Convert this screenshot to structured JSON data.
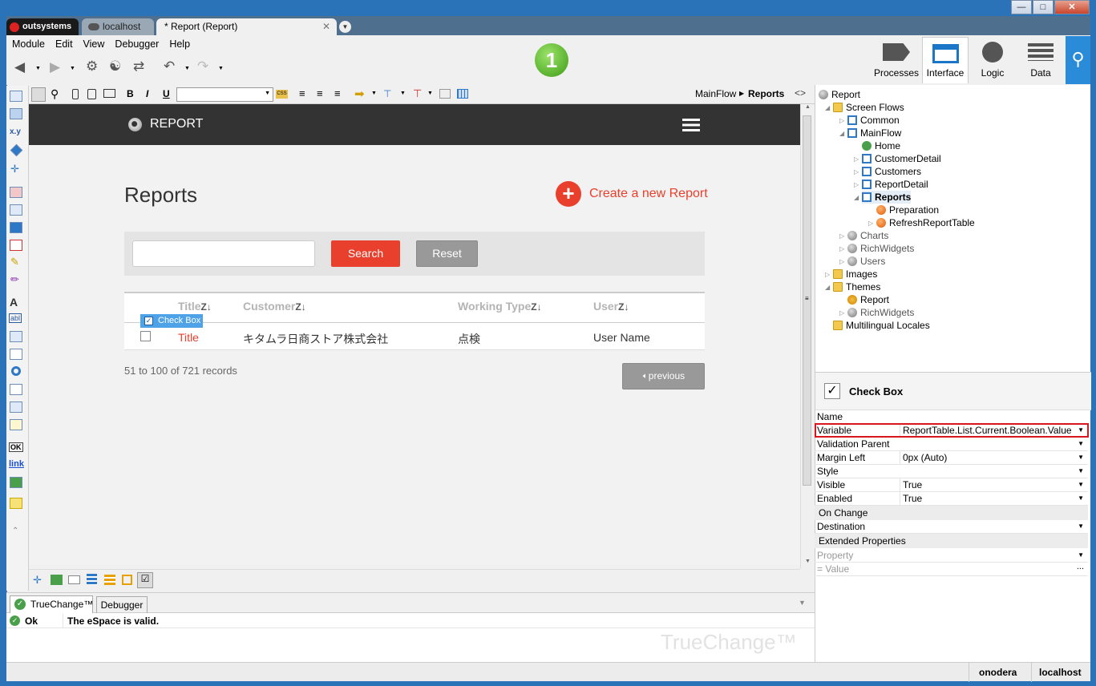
{
  "tabs": {
    "app": "outsystems",
    "server": "localhost",
    "doc": "* Report (Report)"
  },
  "menu": [
    "Module",
    "Edit",
    "View",
    "Debugger",
    "Help"
  ],
  "badge": "1",
  "modes": {
    "processes": "Processes",
    "interface": "Interface",
    "logic": "Logic",
    "data": "Data"
  },
  "breadcrumb": {
    "flow": "MainFlow",
    "screen": "Reports",
    "toggle": "<>"
  },
  "app": {
    "header_title": "REPORT",
    "page_title": "Reports",
    "create_label": "Create a new Report",
    "search_label": "Search",
    "reset_label": "Reset",
    "columns": [
      "Title",
      "Customer",
      "Working Type",
      "User"
    ],
    "sort_glyph": "Z↓",
    "tooltip": "Check Box",
    "row": {
      "title": "Title",
      "customer": "キタムラ日商ストア株式会社",
      "working_type": "点検",
      "user": "User Name"
    },
    "records": "51 to 100 of 721 records",
    "prev_label": "previous"
  },
  "tree": {
    "root": "Report",
    "screen_flows": "Screen Flows",
    "common": "Common",
    "mainflow": "MainFlow",
    "home": "Home",
    "customerdetail": "CustomerDetail",
    "customers": "Customers",
    "reportdetail": "ReportDetail",
    "reports": "Reports",
    "preparation": "Preparation",
    "refresh": "RefreshReportTable",
    "charts": "Charts",
    "richwidgets": "RichWidgets",
    "users": "Users",
    "images": "Images",
    "themes": "Themes",
    "theme_report": "Report",
    "theme_rich": "RichWidgets",
    "locales": "Multilingual Locales"
  },
  "props": {
    "title": "Check Box",
    "rows": [
      {
        "k": "Name",
        "v": ""
      },
      {
        "k": "Variable",
        "v": "ReportTable.List.Current.Boolean.Value"
      },
      {
        "k": "Validation Parent",
        "v": ""
      },
      {
        "k": "Margin Left",
        "v": "0px (Auto)"
      },
      {
        "k": "Style",
        "v": ""
      },
      {
        "k": "Visible",
        "v": "True"
      },
      {
        "k": "Enabled",
        "v": "True"
      }
    ],
    "on_change": "On Change",
    "destination": "Destination",
    "extended": "Extended Properties",
    "property": "Property",
    "value": "=  Value",
    "ellipsis": "..."
  },
  "bottom": {
    "tab1": "TrueChange™",
    "tab2": "Debugger",
    "status": "Ok",
    "message": "The eSpace is valid.",
    "watermark": "TrueChange™"
  },
  "status": {
    "user": "onodera",
    "server": "localhost"
  }
}
